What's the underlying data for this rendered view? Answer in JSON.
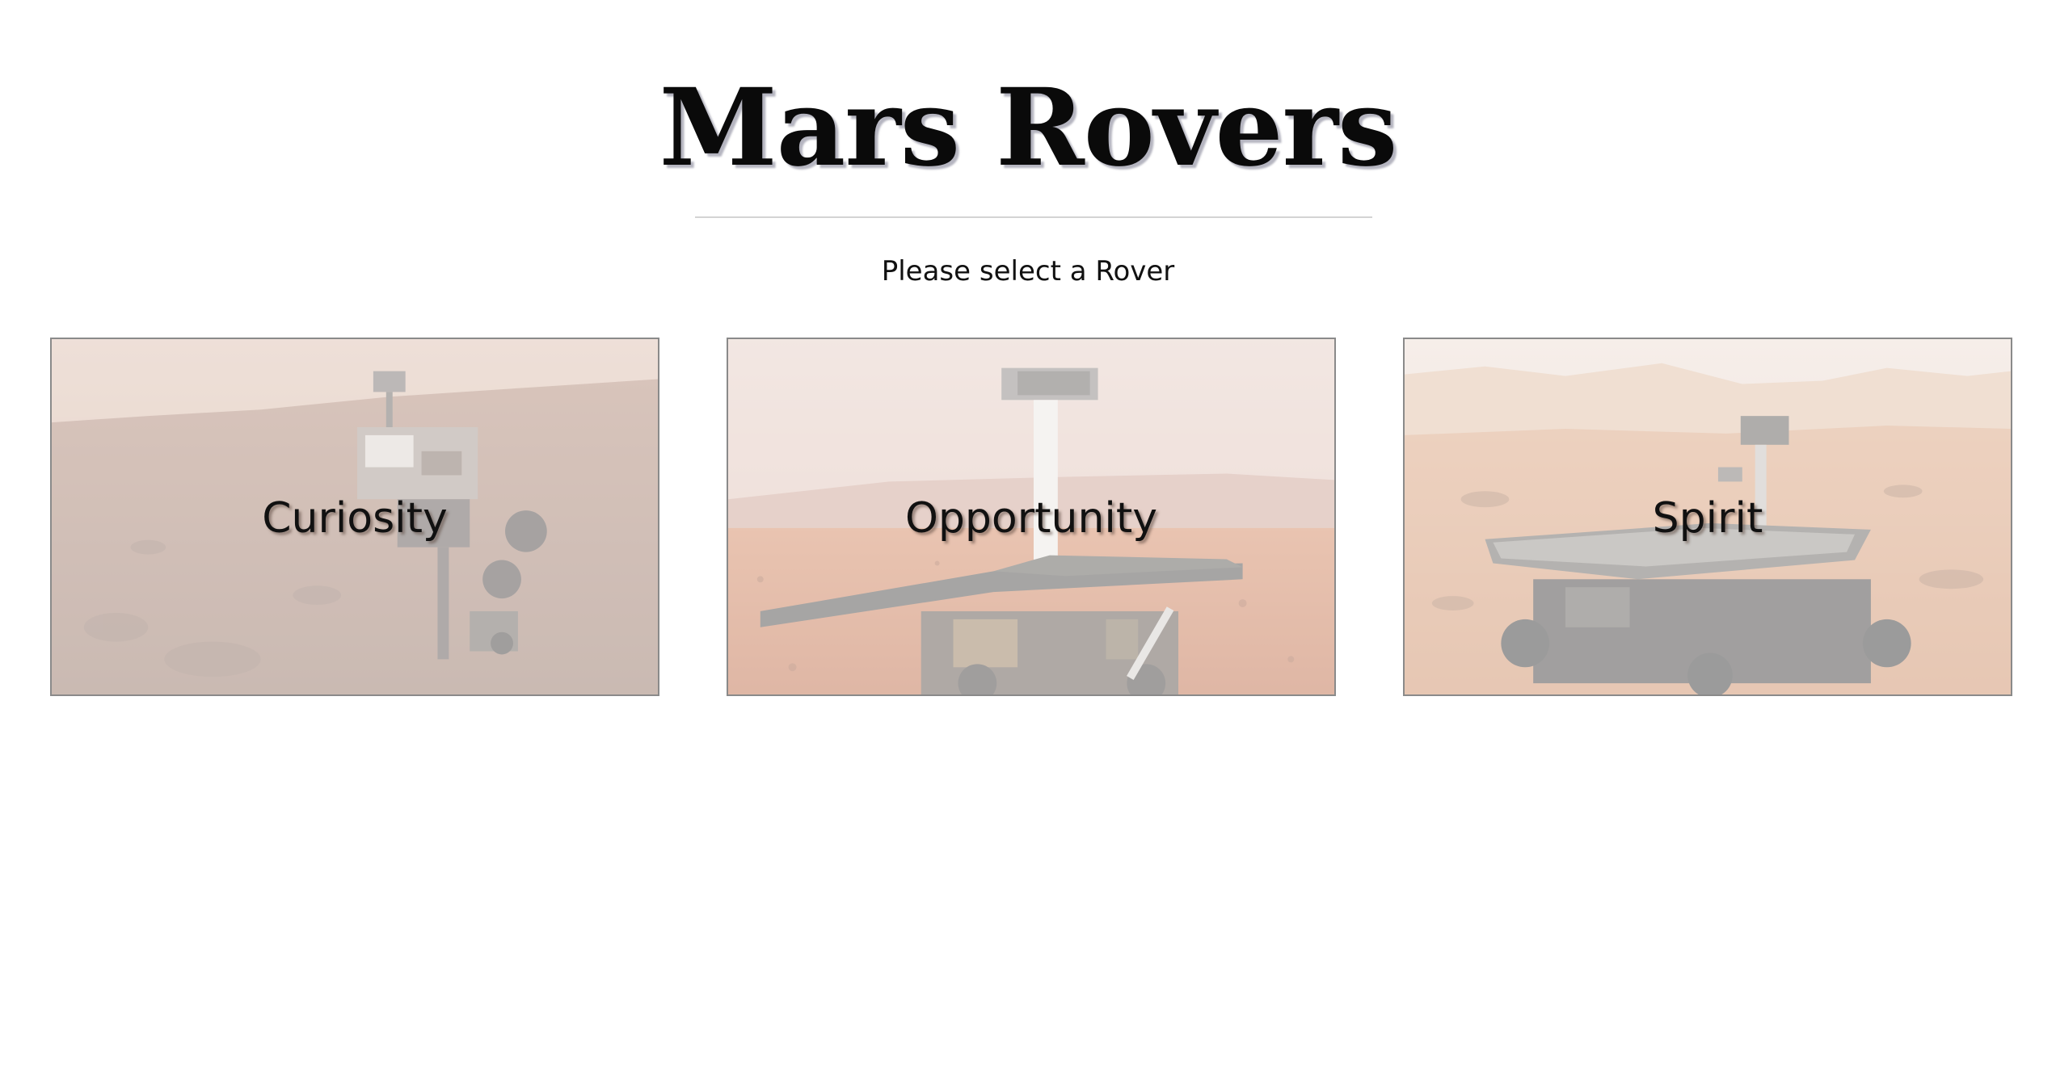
{
  "header": {
    "title": "Mars Rovers",
    "subtitle": "Please select a Rover"
  },
  "rovers": [
    {
      "name": "Curiosity"
    },
    {
      "name": "Opportunity"
    },
    {
      "name": "Spirit"
    }
  ],
  "colors": {
    "background": "#ffffff",
    "title": "#0a0a0a",
    "card_border": "#8a8a8a",
    "mars_sky": "#e9d6cc",
    "mars_ground": "#c88a66"
  }
}
